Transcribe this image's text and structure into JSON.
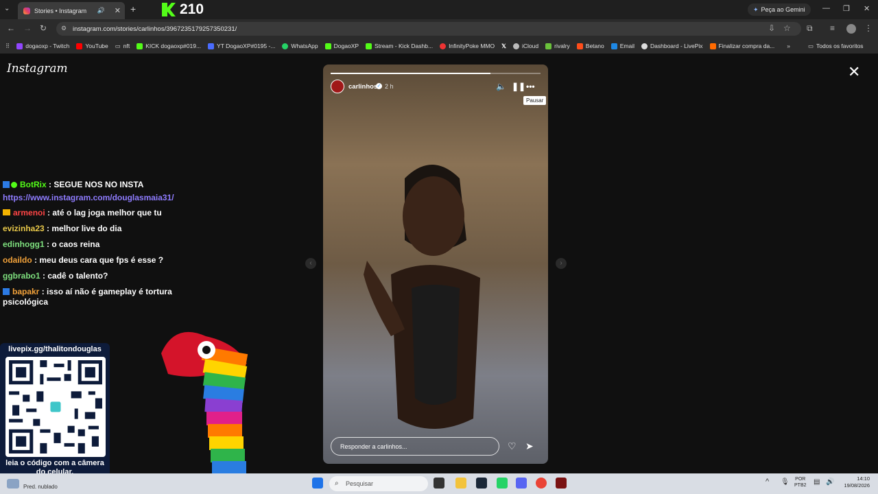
{
  "browser": {
    "tab_title": "Stories • Instagram",
    "new_tab_symbol": "+",
    "gemini_button": "Peça ao Gemini",
    "url": "instagram.com/stories/carlinhos/3967235179257350231/",
    "bookmarks": [
      "dogaoxp - Twitch",
      "YouTube",
      "nft",
      "KICK dogaoxp#019...",
      "YT DogaoXP#0195 -...",
      "WhatsApp",
      "DogaoXP",
      "Stream - Kick Dashb...",
      "InfinityPoke MMO",
      "iCloud",
      "rivalry",
      "Betano",
      "Email",
      "Dashboard - LivePix",
      "Finalizar compra da..."
    ],
    "all_favorites": "Todos os favoritos"
  },
  "kick_overlay": {
    "count": "210"
  },
  "instagram": {
    "logo": "Instagram",
    "close_symbol": "✕",
    "story": {
      "username": "carlinhos",
      "time_ago": "2 h",
      "pause_tooltip": "Pausar",
      "reply_placeholder": "Responder a carlinhos...",
      "progress": 0.76
    }
  },
  "chat": {
    "lines": [
      {
        "user": "BotRix",
        "message": "SEGUE NOS NO INSTA",
        "color": "#53fc18"
      },
      {
        "user": "armenoi",
        "message": "até o lag joga melhor que tu",
        "color": "#ff4545"
      },
      {
        "user": "evizinha23",
        "message": "melhor live do dia",
        "color": "#e8c84a"
      },
      {
        "user": "edinhogg1",
        "message": "o caos reina",
        "color": "#7ee07e"
      },
      {
        "user": "odaildo",
        "message": "meu deus cara que fps é esse ?",
        "color": "#f2a23a"
      },
      {
        "user": "ggbrabo1",
        "message": "cadê o talento?",
        "color": "#7ee07e"
      },
      {
        "user": "bapakr",
        "message": "isso aí não é gameplay é tortura psicológica",
        "color": "#f2a23a"
      }
    ],
    "link": "https://www.instagram.com/douglasmaia31/"
  },
  "livepix": {
    "title": "livepix.gg/thalitondouglas",
    "caption": "leia o código com a câmera do celular."
  },
  "taskbar": {
    "weather": "Pred. nublado",
    "search_placeholder": "Pesquisar",
    "lang_line1": "POR",
    "lang_line2": "PTB2",
    "time": "14:10",
    "date": "19/08/2026"
  }
}
